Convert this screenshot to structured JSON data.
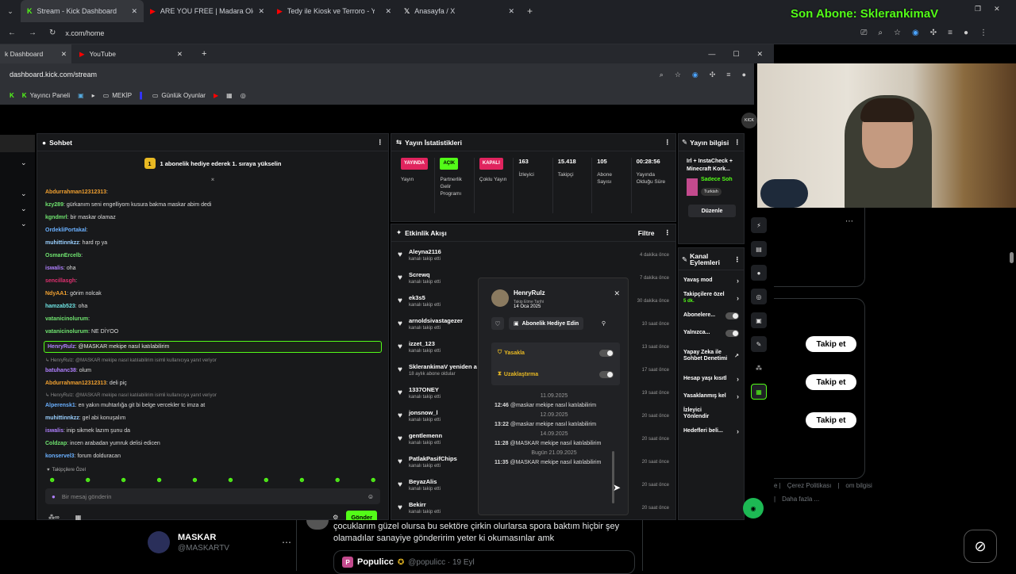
{
  "browser_outer": {
    "tabs": [
      "Stream - Kick Dashboard",
      "ARE YOU FREE | Madara Olduk",
      "Tedy ile Kiosk ve Terroro - YouT",
      "Anasayfa / X"
    ],
    "url": "x.com/home"
  },
  "overlay": {
    "sub_label": "Son Abone: SklerankimaV"
  },
  "browser_inner": {
    "tabs": [
      "k Dashboard",
      "YouTube"
    ],
    "url": "dashboard.kick.com/stream",
    "bookmarks": [
      "Yayıncı Paneli",
      "MEKİP",
      "Günlük Oyunlar"
    ]
  },
  "chat": {
    "title": "Sohbet",
    "gift_banner": "1 abonelik hediye ederek 1. sıraya yükselin",
    "gift_count": "1",
    "messages": [
      {
        "user": "Abdurrahman12312313",
        "text": ":",
        "color": "#f0a030"
      },
      {
        "user": "kzy289",
        "text": ": gürkanım seni engelliyom kusura bakma maskar abim dedi",
        "color": "#6fe36f"
      },
      {
        "user": "kgndmrl",
        "text": ": bir maskar olamaz",
        "color": "#6fe36f"
      },
      {
        "user": "OrdekliPortakal",
        "text": ":",
        "color": "#6ab0ff"
      },
      {
        "user": "muhittinnkzz",
        "text": ": hard rp ya",
        "color": "#9ad0ff"
      },
      {
        "user": "OsmanErcelb",
        "text": ":",
        "color": "#6fe36f"
      },
      {
        "user": "iswalis",
        "text": ": oha",
        "color": "#b080ff"
      },
      {
        "user": "sencillasgh",
        "text": ":",
        "color": "#e03070"
      },
      {
        "user": "NdyAA1",
        "text": ": görim nolcak",
        "color": "#f0a030"
      },
      {
        "user": "hamzab523",
        "text": ": oha",
        "color": "#6fe3e3"
      },
      {
        "user": "vatanicinolurum",
        "text": ":",
        "color": "#6fe36f"
      },
      {
        "user": "vatanicinolurum",
        "text": ": NE DİYOO",
        "color": "#6fe36f"
      }
    ],
    "highlight": {
      "user": "HenryRulz",
      "text": ": @MASKAR mekipe nasıl katılabilirim"
    },
    "messages2": [
      {
        "reply": "↳ HenryRulz: @MASKAR mekipe nasıl katılabilirim isimli kullanıcıya yanıt veriyor",
        "user": "batuhanc38",
        "text": ": olum",
        "color": "#b080ff"
      },
      {
        "reply": "",
        "user": "Abdurrahman12312313",
        "text": ": deli piç",
        "color": "#f0a030"
      },
      {
        "reply": "↳ HenryRulz: @MASKAR mekipe nasıl katılabilirim isimli kullanıcıya yanıt veriyor",
        "user": "Alperensk1",
        "text": ": en yakın muhtarlığa git bi belge vercekler tc imza at",
        "color": "#6ab0ff"
      },
      {
        "reply": "",
        "user": "muhittinnkzz",
        "text": ": gel abi konuşalım",
        "color": "#9ad0ff"
      },
      {
        "reply": "",
        "user": "iswalis",
        "text": ": inip sikmek lazım şunu da",
        "color": "#b080ff"
      },
      {
        "reply": "",
        "user": "Coldzap",
        "text": ": incen arabadan yumruk delisi edicen",
        "color": "#6fe36f"
      },
      {
        "reply": "",
        "user": "konservel3",
        "text": ": forum dolduracan",
        "color": "#6ab0ff"
      }
    ],
    "followers_only": "Takipçilere Özel",
    "input_placeholder": "Bir mesaj gönderin",
    "send_label": "Gönder"
  },
  "stats": {
    "title": "Yayın İstatistikleri",
    "items": [
      {
        "badge": "YAYINDA",
        "badge_color": "#e0245e",
        "label": "Yayın"
      },
      {
        "badge": "AÇIK",
        "badge_color": "#53fc18",
        "label": "Partnerlik Gelir Programı"
      },
      {
        "badge": "KAPALI",
        "badge_color": "#e0245e",
        "label": "Çoklu Yayın"
      },
      {
        "value": "163",
        "label": "İzleyici"
      },
      {
        "value": "15.418",
        "label": "Takipçi"
      },
      {
        "value": "105",
        "label": "Abone Sayısı"
      },
      {
        "value": "00:28:56",
        "label": "Yayında Olduğu Süre"
      }
    ]
  },
  "feed": {
    "title": "Etkinlik Akışı",
    "filter": "Filtre",
    "items": [
      {
        "name": "Aleyna2116",
        "sub": "kanalı takip etti",
        "time": "4 dakika önce"
      },
      {
        "name": "Screwq",
        "sub": "kanalı takip etti",
        "time": "7 dakika önce"
      },
      {
        "name": "ek3s5",
        "sub": "kanalı takip etti",
        "time": "30 dakika önce"
      },
      {
        "name": "arnoldsivastagezer",
        "sub": "kanalı takip etti",
        "time": "10 saat önce"
      },
      {
        "name": "izzet_123",
        "sub": "kanalı takip etti",
        "time": "13 saat önce"
      },
      {
        "name": "SklerankimaV yeniden a",
        "sub": "18 aylık abone oldular",
        "time": "17 saat önce"
      },
      {
        "name": "1337ONEY",
        "sub": "kanalı takip etti",
        "time": "19 saat önce"
      },
      {
        "name": "jonsnow_l",
        "sub": "kanalı takip etti",
        "time": "20 saat önce"
      },
      {
        "name": "gentlemenn",
        "sub": "kanalı takip etti",
        "time": "20 saat önce"
      },
      {
        "name": "PatlakPasifChips",
        "sub": "kanalı takip etti",
        "time": "20 saat önce"
      },
      {
        "name": "BeyazAlis",
        "sub": "kanalı takip etti",
        "time": "20 saat önce"
      },
      {
        "name": "Bekirr",
        "sub": "kanalı takip etti",
        "time": "20 saat önce"
      }
    ]
  },
  "popup": {
    "username": "HenryRulz",
    "follow_label": "Takip Etme Tarihi",
    "follow_date": "14 Oca 2025",
    "gift_button": "Abonelik Hediye Edin",
    "ban_label": "Yasakla",
    "timeout_label": "Uzaklaştırma",
    "history": [
      {
        "date": "11.09.2025",
        "time": "12:46",
        "text": "@maskar mekipe nasıl katılabilirim"
      },
      {
        "date": "12.09.2025",
        "time": "13:22",
        "text": "@maskar mekipe nasıl katılabilirim"
      },
      {
        "date": "14.09.2025",
        "time": "11:28",
        "text": "@MASKAR mekipe nasıl katılabilirim"
      },
      {
        "date": "Bugün 21.09.2025",
        "time": "11:35",
        "text": "@MASKAR mekipe nasıl katılabilirim"
      }
    ]
  },
  "info": {
    "title": "Yayın bilgisi",
    "stream_title": "Irl + InstaCheck + Minecraft Kork...",
    "category": "Sadece Soh",
    "tag": "Turkish",
    "edit_button": "Düzenle"
  },
  "actions": {
    "title": "Kanal Eylemleri",
    "items": [
      {
        "label": "Yavaş mod",
        "sub": "",
        "control": "chevron"
      },
      {
        "label": "Takipçilere özel",
        "sub": "5 dk.",
        "control": "chevron"
      },
      {
        "label": "Abonelere...",
        "sub": "",
        "control": "toggle"
      },
      {
        "label": "Yalnızca...",
        "sub": "",
        "control": "toggle"
      },
      {
        "label": "Yapay Zeka ile Sohbet Denetimi",
        "sub": "",
        "control": "external"
      },
      {
        "label": "Hesap yaşı kısıtl",
        "sub": "",
        "control": "chevron"
      },
      {
        "label": "Yasaklanmış kel",
        "sub": "",
        "control": "chevron"
      },
      {
        "label": "İzleyici Yönlendir",
        "sub": "",
        "control": "none"
      },
      {
        "label": "Hedefleri beli...",
        "sub": "",
        "control": "chevron"
      }
    ]
  },
  "x_page": {
    "follow_buttons": [
      "Takip et",
      "Takip et",
      "Takip et"
    ],
    "footer_links": [
      "Çerez Politikası",
      "om bilgisi",
      "Daha fazla ..."
    ],
    "profile_name": "MASKAR",
    "profile_handle": "@MASKARTV",
    "tweet_text": "çocuklarım güzel olursa bu sektöre çirkin olurlarsa spora baktım hiçbir şey olamadılar sanayiye gönderirim yeter ki okumasınlar amk",
    "quote_name": "Populicc",
    "quote_handle": "@populicc · 19 Eyl"
  },
  "colors": {
    "kick_green": "#53fc18",
    "accent_red": "#e0245e"
  }
}
